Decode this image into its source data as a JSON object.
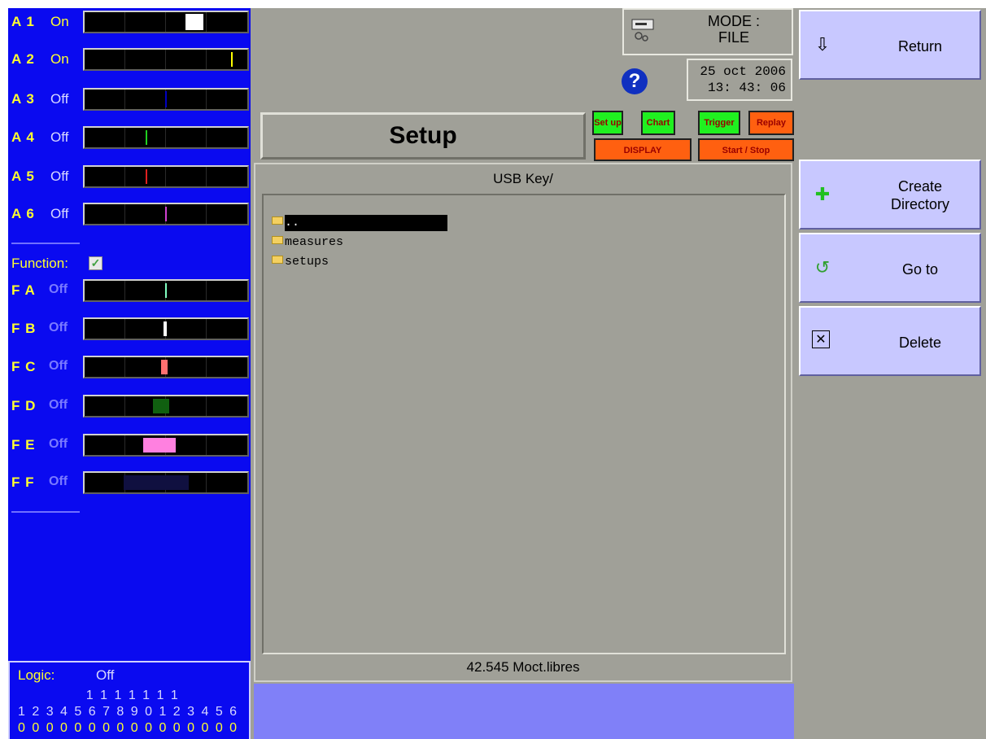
{
  "channels": [
    {
      "name": "A 1",
      "state": "On",
      "mark_color": "#ffffff"
    },
    {
      "name": "A 2",
      "state": "On",
      "mark_color": "#ffff00"
    },
    {
      "name": "A 3",
      "state": "Off",
      "mark_color": "#0000c0"
    },
    {
      "name": "A 4",
      "state": "Off",
      "mark_color": "#20d020"
    },
    {
      "name": "A 5",
      "state": "Off",
      "mark_color": "#e02020"
    },
    {
      "name": "A 6",
      "state": "Off",
      "mark_color": "#d040d0"
    }
  ],
  "function_label": "Function:",
  "functions": [
    {
      "name": "F A",
      "state": "Off",
      "mark_color": "#80ffc0"
    },
    {
      "name": "F B",
      "state": "Off",
      "mark_color": "#ffffff"
    },
    {
      "name": "F C",
      "state": "Off",
      "mark_color": "#ff7070"
    },
    {
      "name": "F D",
      "state": "Off",
      "mark_color": "#106010"
    },
    {
      "name": "F E",
      "state": "Off",
      "mark_color": "#ff80e0"
    },
    {
      "name": "F F",
      "state": "Off",
      "mark_color": "#101040"
    }
  ],
  "logic": {
    "label": "Logic:",
    "value": "Off",
    "row1": "             1 1 1 1 1 1 1",
    "row2": "1 2 3 4 5 6 7 8 9 0 1 2 3 4 5 6",
    "row3": "0 0 0 0 0 0 0 0 0 0 0 0 0 0 0 0"
  },
  "mode": {
    "line1": "MODE :",
    "line2": "FILE"
  },
  "help_glyph": "?",
  "date": "25 oct 2006",
  "time": "13: 43: 06",
  "title": "Setup",
  "tabs": {
    "setup": "Set up",
    "chart": "Chart",
    "trigger": "Trigger",
    "replay": "Replay",
    "display": "DISPLAY",
    "startstop": "Start / Stop"
  },
  "browser": {
    "path": "USB Key/",
    "files": [
      "..",
      "measures",
      "setups"
    ],
    "free_space": "42.545 Moct.libres"
  },
  "softkeys": {
    "return": "Return",
    "create_dir_1": "Create",
    "create_dir_2": "Directory",
    "goto": "Go to",
    "delete": "Delete"
  }
}
